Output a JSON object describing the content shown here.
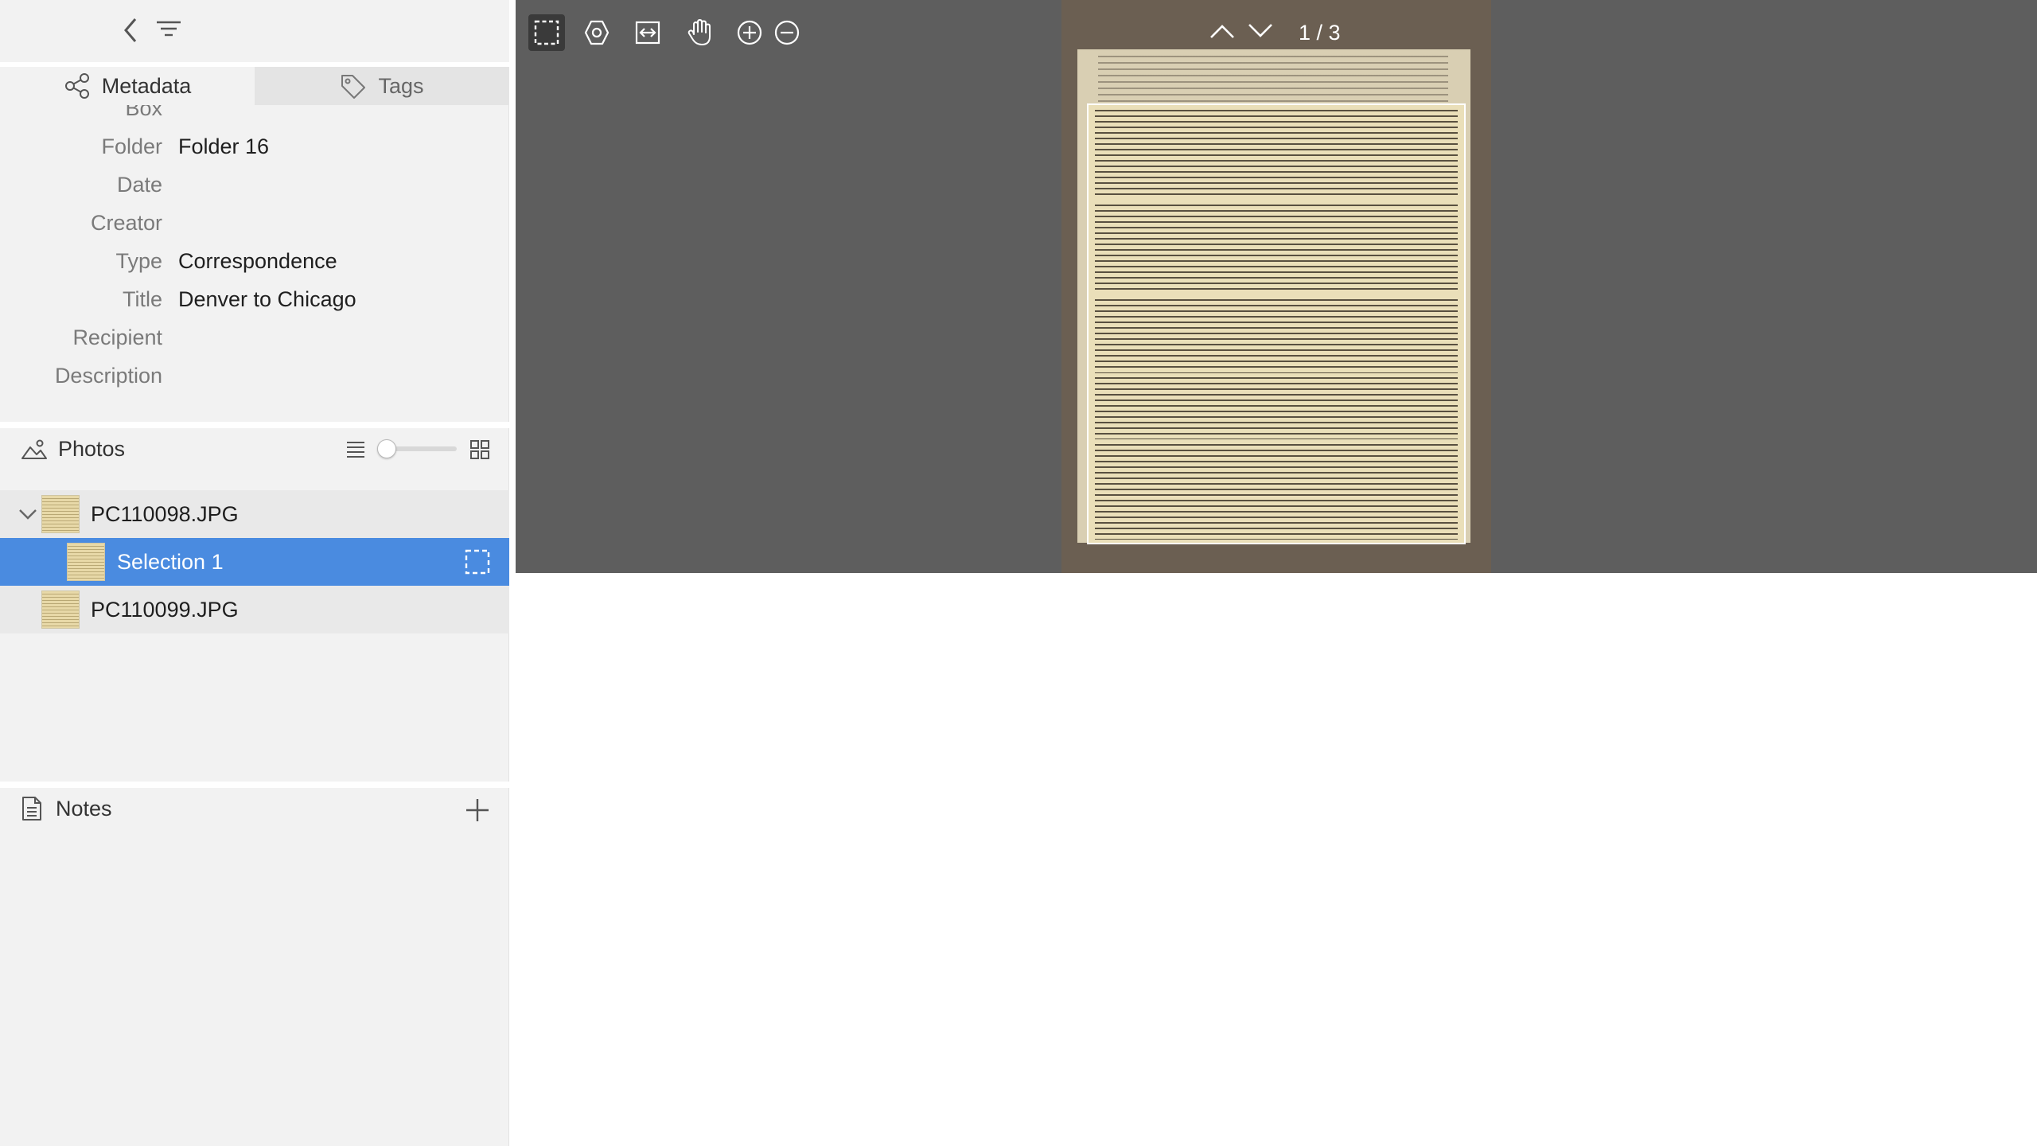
{
  "metadata_tab": {
    "label": "Metadata"
  },
  "tags_tab": {
    "label": "Tags"
  },
  "metadata_fields": [
    {
      "label": "Box",
      "value": ""
    },
    {
      "label": "Folder",
      "value": "Folder 16"
    },
    {
      "label": "Date",
      "value": ""
    },
    {
      "label": "Creator",
      "value": ""
    },
    {
      "label": "Type",
      "value": "Correspondence"
    },
    {
      "label": "Title",
      "value": "Denver to Chicago"
    },
    {
      "label": "Recipient",
      "value": ""
    },
    {
      "label": "Description",
      "value": ""
    }
  ],
  "photos": {
    "title": "Photos",
    "thumbnail_size": 0,
    "items": [
      {
        "name": "PC110098.JPG",
        "expanded": true
      },
      {
        "name": "Selection 1",
        "selected": true
      },
      {
        "name": "PC110099.JPG"
      }
    ]
  },
  "notes": {
    "title": "Notes"
  },
  "viewer": {
    "page_indicator": "1 / 3",
    "tools": [
      "selection-tool",
      "focus-tool",
      "fit-width",
      "pan-hand",
      "zoom-in",
      "zoom-out"
    ]
  },
  "colors": {
    "selection_highlight": "#4a8be0",
    "viewer_background": "#5e5e5e",
    "sidebar_background": "#f2f2f2"
  }
}
